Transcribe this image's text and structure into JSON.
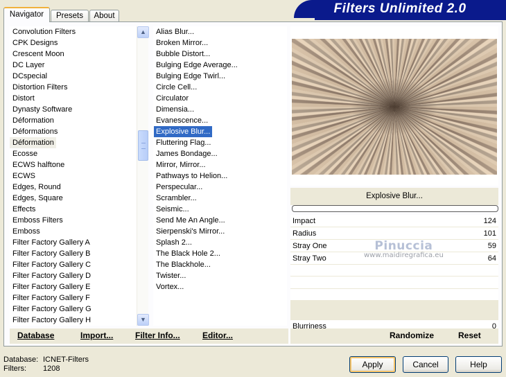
{
  "tabs": [
    "Navigator",
    "Presets",
    "About"
  ],
  "title": "Filters Unlimited 2.0",
  "categories": {
    "items": [
      "Convolution Filters",
      "CPK Designs",
      "Crescent Moon",
      "DC Layer",
      "DCspecial",
      "Distortion Filters",
      "Distort",
      "Dynasty Software",
      "Déformation",
      "Déformations",
      "Déformation",
      "Ecosse",
      "ECWS halftone",
      "ECWS",
      "Edges, Round",
      "Edges, Square",
      "Effects",
      "Emboss Filters",
      "Emboss",
      "Filter Factory Gallery A",
      "Filter Factory Gallery B",
      "Filter Factory Gallery C",
      "Filter Factory Gallery D",
      "Filter Factory Gallery E",
      "Filter Factory Gallery F",
      "Filter Factory Gallery G",
      "Filter Factory Gallery H"
    ],
    "selected_index": 10
  },
  "scrollbar": {
    "up_icon": "chevron-up-icon",
    "down_icon": "chevron-down-icon"
  },
  "filters": {
    "items": [
      "Alias Blur...",
      "Broken Mirror...",
      "Bubble Distort...",
      "Bulging Edge Average...",
      "Bulging Edge Twirl...",
      "Circle Cell...",
      "Circulator",
      "Dimensia...",
      "Evanescence...",
      "Explosive Blur...",
      "Fluttering Flag...",
      "James Bondage...",
      "Mirror, Mirror...",
      "Pathways to Helion...",
      "Perspecular...",
      "Scrambler...",
      "Seismic...",
      "Send Me An Angle...",
      "Sierpenski's Mirror...",
      "Splash 2...",
      "The Black Hole 2...",
      "The Blackhole...",
      "Twister...",
      "Vortex..."
    ],
    "selected_index": 9
  },
  "preview": {
    "filter_name": "Explosive Blur...",
    "progress": 0
  },
  "params": [
    {
      "label": "Impact",
      "value": "124"
    },
    {
      "label": "Radius",
      "value": "101"
    },
    {
      "label": "Stray One",
      "value": "59"
    },
    {
      "label": "Stray Two",
      "value": "64"
    },
    {
      "label": "",
      "value": ""
    },
    {
      "label": "",
      "value": ""
    },
    {
      "label": "",
      "value": ""
    },
    {
      "label": "Blurriness",
      "value": "0"
    }
  ],
  "watermark": {
    "line1": "Pinuccia",
    "line2": "www.maidiregrafica.eu"
  },
  "toolbar": {
    "database": "Database",
    "import": "Import...",
    "filter_info": "Filter Info...",
    "editor": "Editor...",
    "randomize": "Randomize",
    "reset": "Reset"
  },
  "info": {
    "database_label": "Database:",
    "database_value": "ICNET-Filters",
    "filters_label": "Filters:",
    "filters_value": "1208"
  },
  "buttons": {
    "apply": "Apply",
    "cancel": "Cancel",
    "help": "Help"
  },
  "colors": {
    "banner": "#0a1a8c",
    "selection": "#316ac5",
    "background": "#ece9d8"
  }
}
